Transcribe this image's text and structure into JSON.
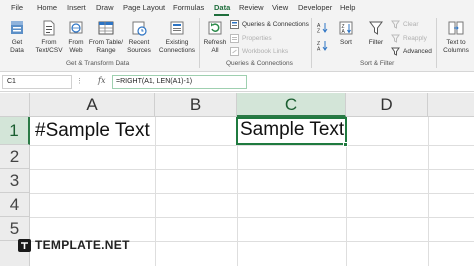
{
  "menu": {
    "tabs": [
      "File",
      "Home",
      "Insert",
      "Draw",
      "Page Layout",
      "Formulas",
      "Data",
      "Review",
      "View",
      "Developer",
      "Help"
    ],
    "active": "Data"
  },
  "ribbon": {
    "get_transform": {
      "get_data": [
        "Get",
        "Data"
      ],
      "from_text_csv": [
        "From",
        "Text/CSV"
      ],
      "from_web": [
        "From",
        "Web"
      ],
      "from_table_range": [
        "From Table/",
        "Range"
      ],
      "recent_sources": [
        "Recent",
        "Sources"
      ],
      "existing_connections": [
        "Existing",
        "Connections"
      ],
      "label": "Get & Transform Data"
    },
    "queries": {
      "refresh_all": [
        "Refresh",
        "All"
      ],
      "queries_connections": "Queries & Connections",
      "properties": "Properties",
      "workbook_links": "Workbook Links",
      "label": "Queries & Connections"
    },
    "sort_filter": {
      "sort": "Sort",
      "filter": "Filter",
      "clear": "Clear",
      "reapply": "Reapply",
      "advanced": "Advanced",
      "label": "Sort & Filter"
    },
    "data_tools": {
      "text_to_columns": [
        "Text to",
        "Columns"
      ]
    }
  },
  "formula_bar": {
    "name_box": "C1",
    "fx": "fx",
    "formula": "=RIGHT(A1, LEN(A1)-1)"
  },
  "sheet": {
    "columns": [
      "A",
      "B",
      "C",
      "D"
    ],
    "selected_column": "C",
    "rows": [
      "1",
      "2",
      "3",
      "4",
      "5"
    ],
    "selected_row": "1",
    "cells": {
      "A1": "#Sample Text",
      "C1": "Sample Text"
    }
  },
  "watermark": "TEMPLATE.NET",
  "colors": {
    "accent": "#1f7a3f",
    "header_bg": "#ececec",
    "selected_header": "#d3e5d8"
  }
}
